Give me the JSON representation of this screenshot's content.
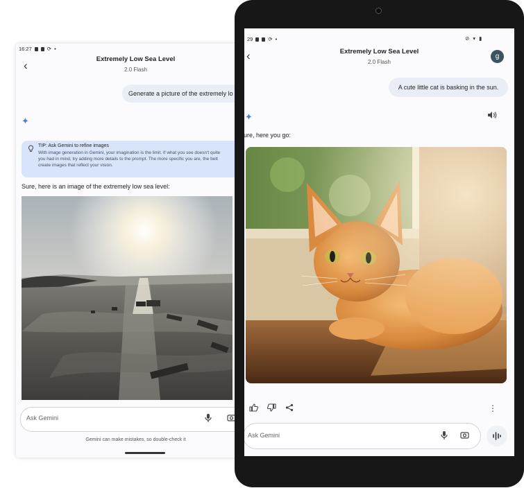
{
  "phone": {
    "status_time": "16:27",
    "title": "Extremely Low Sea Level",
    "subtitle": "2.0 Flash",
    "user_message": "Generate a picture of the extremely lo",
    "tip_title": "TIP: Ask Gemini to refine images",
    "tip_lines": [
      "With image generation in Gemini, your imagination is the limit. If what you see doesn't quite",
      "you had in mind, try adding more details to the prompt. The more specific you are, the bett",
      "create images that reflect your vision."
    ],
    "reply": "Sure, here is an image of the extremely low sea level:",
    "input_placeholder": "Ask Gemini",
    "disclaimer": "Gemini can make mistakes, so double-check it"
  },
  "tablet": {
    "status_time": "29",
    "title": "Extremely Low Sea Level",
    "subtitle": "2.0 Flash",
    "avatar_letter": "g",
    "user_message": "A cute little cat is basking in the sun.",
    "reply": "ure, here you go:",
    "input_placeholder": "Ask Gemini"
  },
  "colors": {
    "accent": "#4a7ed8",
    "tip_bg": "#d7e4fb",
    "bubble_bg": "#e9eef6",
    "tablet_bezel": "#171717",
    "avatar_bg": "#3a5560"
  },
  "icons": [
    "back-arrow-icon",
    "sparkle-icon",
    "lightbulb-icon",
    "mic-icon",
    "camera-icon",
    "speaker-icon",
    "thumbs-up-icon",
    "thumbs-down-icon",
    "share-icon",
    "more-vert-icon",
    "live-waveform-icon"
  ]
}
